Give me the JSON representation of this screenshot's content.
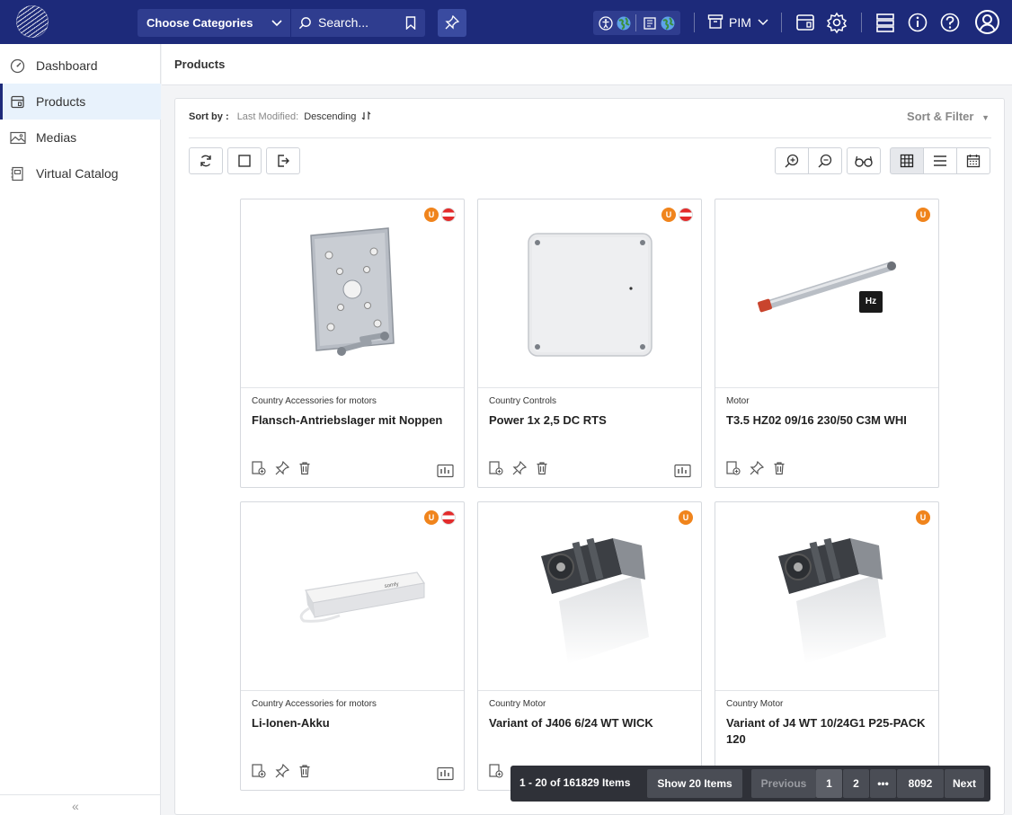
{
  "topbar": {
    "category_select": "Choose Categories",
    "search_placeholder": "Search...",
    "pim_label": "PIM"
  },
  "sidebar": {
    "items": [
      {
        "label": "Dashboard",
        "icon": "dashboard-icon"
      },
      {
        "label": "Products",
        "icon": "products-icon"
      },
      {
        "label": "Medias",
        "icon": "image-icon"
      },
      {
        "label": "Virtual Catalog",
        "icon": "catalog-icon"
      }
    ],
    "collapse": "«"
  },
  "header": {
    "title": "Products"
  },
  "toolbar": {
    "sort_label": "Sort by :",
    "sort_field": "Last Modified:",
    "sort_value": "Descending",
    "sort_filter": "Sort & Filter"
  },
  "products": [
    {
      "category": "Country Accessories for motors",
      "title": "Flansch-Antriebslager mit Noppen",
      "badge": "U",
      "flag": true,
      "image": "metal-flange-plate"
    },
    {
      "category": "Country Controls",
      "title": "Power 1x 2,5 DC RTS",
      "badge": "U",
      "flag": true,
      "image": "grey-junction-box"
    },
    {
      "category": "Motor",
      "title": "T3.5 HZ02 09/16 230/50 C3M WHI",
      "badge": "U",
      "flag": false,
      "image": "tubular-motor"
    },
    {
      "category": "Country Accessories for motors",
      "title": "Li-Ionen-Akku",
      "badge": "U",
      "flag": true,
      "image": "battery-pack"
    },
    {
      "category": "Country Motor",
      "title": "Variant of J406 6/24 WT WICK",
      "badge": "U",
      "flag": false,
      "image": "motor-drive"
    },
    {
      "category": "Country Motor",
      "title": "Variant of J4 WT 10/24G1 P25-PACK 120",
      "badge": "U",
      "flag": false,
      "image": "motor-drive"
    }
  ],
  "pagination": {
    "info": "1 - 20 of 161829 Items",
    "show": "Show 20 Items",
    "previous": "Previous",
    "pages": [
      "1",
      "2",
      "•••",
      "8092"
    ],
    "next": "Next"
  },
  "colors": {
    "topbar": "#1d2a7a",
    "badge": "#f0841c",
    "pager": "#2f3138"
  }
}
